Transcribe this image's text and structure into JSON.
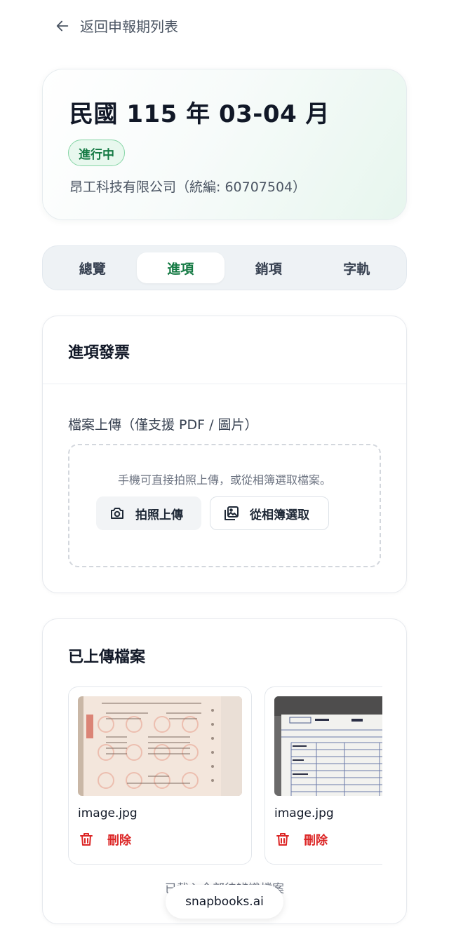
{
  "nav": {
    "back_label": "返回申報期列表"
  },
  "period": {
    "title": "民國 115 年 03-04 月",
    "status": "進行中",
    "company": "昂工科技有限公司（統編: 60707504）"
  },
  "tabs": [
    {
      "label": "總覽"
    },
    {
      "label": "進項",
      "active": true
    },
    {
      "label": "銷項"
    },
    {
      "label": "字軌"
    }
  ],
  "purchase_invoices": {
    "title": "進項發票",
    "upload_label": "檔案上傳（僅支援 PDF / 圖片）",
    "hint": "手機可直接拍照上傳，或從相簿選取檔案。",
    "camera_button": "拍照上傳",
    "gallery_button": "從相簿選取"
  },
  "uploaded_files": {
    "title": "已上傳檔案",
    "items": [
      {
        "name": "image.jpg",
        "delete_label": "刪除"
      },
      {
        "name": "image.jpg",
        "delete_label": "刪除"
      }
    ],
    "footer_note": "已載入全部待辨識檔案"
  },
  "brand": {
    "label": "snapbooks.ai"
  },
  "colors": {
    "accent_green": "#157a44",
    "badge_bg": "#e8f8ee",
    "danger": "#dc2626"
  }
}
